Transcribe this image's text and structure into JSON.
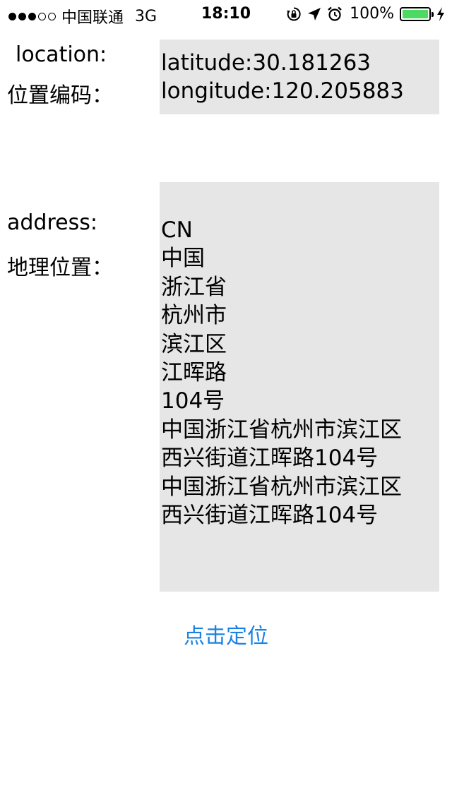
{
  "status_bar": {
    "carrier": "中国联通",
    "network": "3G",
    "time": "18:10",
    "battery": "100%",
    "battery_color": "#4cd964",
    "icons": [
      "signal-dots-icon",
      "orientation-lock-icon",
      "location-arrow-icon",
      "alarm-icon",
      "battery-icon",
      "charging-bolt-icon"
    ]
  },
  "location": {
    "label_en": "location:",
    "label_zh": "位置编码：",
    "latitude": "latitude:30.181263",
    "longitude": "longitude:120.205883"
  },
  "address": {
    "label_en": "address:",
    "label_zh": "地理位置：",
    "lines": [
      "CN",
      "中国",
      "浙江省",
      "杭州市",
      "滨江区",
      "江晖路",
      "104号",
      "中国浙江省杭州市滨江区",
      "西兴街道江晖路104号",
      "中国浙江省杭州市滨江区",
      "西兴街道江晖路104号"
    ]
  },
  "actions": {
    "locate_label": "点击定位",
    "locate_color": "#1a82e3"
  }
}
